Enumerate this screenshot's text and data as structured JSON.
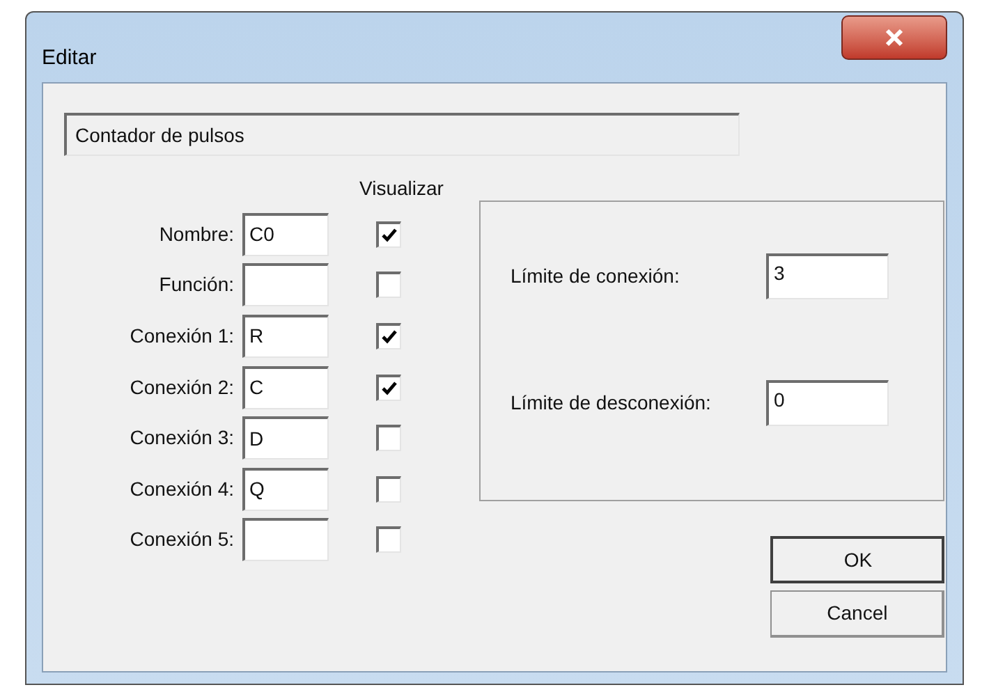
{
  "window": {
    "title": "Editar"
  },
  "description": {
    "value": "Contador de pulsos"
  },
  "visualize_header": "Visualizar",
  "fields": [
    {
      "label": "Nombre:",
      "value": "C0",
      "checked": true
    },
    {
      "label": "Función:",
      "checked": false
    },
    {
      "label": "Conexión 1:",
      "value": "R",
      "checked": true
    },
    {
      "label": "Conexión 2:",
      "value": "C",
      "checked": true
    },
    {
      "label": "Conexión 3:",
      "value": "D",
      "checked": false
    },
    {
      "label": "Conexión 4:",
      "value": "Q",
      "checked": false
    },
    {
      "label": "Conexión 5:",
      "checked": false
    }
  ],
  "limits": [
    {
      "label": "Límite de conexión:",
      "value": "3"
    },
    {
      "label": "Límite de desconexión:",
      "value": "0"
    }
  ],
  "buttons": [
    "OK",
    "Cancel"
  ]
}
